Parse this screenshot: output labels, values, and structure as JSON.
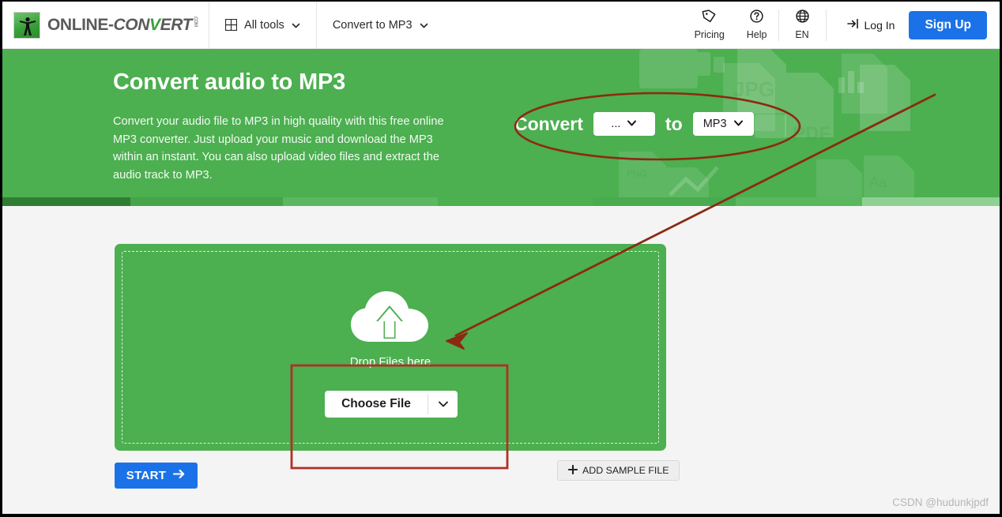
{
  "header": {
    "logo": {
      "part1": "ONLINE",
      "dash": "-",
      "part2": "CON",
      "part3": "V",
      "part4": "ERT",
      "domain": ".COM"
    },
    "nav": [
      {
        "label": "All tools",
        "icon": "grid-icon",
        "caret": "chevron-down-icon"
      },
      {
        "label": "Convert to MP3",
        "icon": null,
        "caret": "chevron-down-icon"
      }
    ],
    "pricing_label": "Pricing",
    "pricing_icon": "tag-icon",
    "help_label": "Help",
    "help_icon": "question-circle-icon",
    "lang_label": "EN",
    "lang_icon": "globe-icon",
    "login_label": "Log In",
    "login_icon": "login-arrow-icon",
    "signup_label": "Sign Up"
  },
  "hero": {
    "title": "Convert audio to MP3",
    "description": "Convert your audio file to MP3 in high quality with this free online MP3 converter. Just upload your music and download the MP3 within an instant. You can also upload video files and extract the audio track to MP3.",
    "convert_label": "Convert",
    "to_label": "to",
    "source_format": "...",
    "target_format": "MP3",
    "background_color": "#4caf50",
    "deco_labels": [
      "JPG",
      "PDF",
      "PNG",
      "Aa"
    ]
  },
  "main": {
    "drop_label": "Drop Files here",
    "drop_icon": "cloud-upload-icon",
    "choose_file_label": "Choose File",
    "choose_file_caret": "chevron-down-icon",
    "start_label": "START",
    "start_icon": "arrow-right-icon",
    "sample_label": "ADD SAMPLE FILE",
    "sample_icon": "plus-icon",
    "watermark": "CSDN @hudunkjpdf"
  },
  "annotations": {
    "ellipse_color": "#8b2a12",
    "rect_color": "#b03025",
    "arrow_color": "#8b2a12"
  }
}
